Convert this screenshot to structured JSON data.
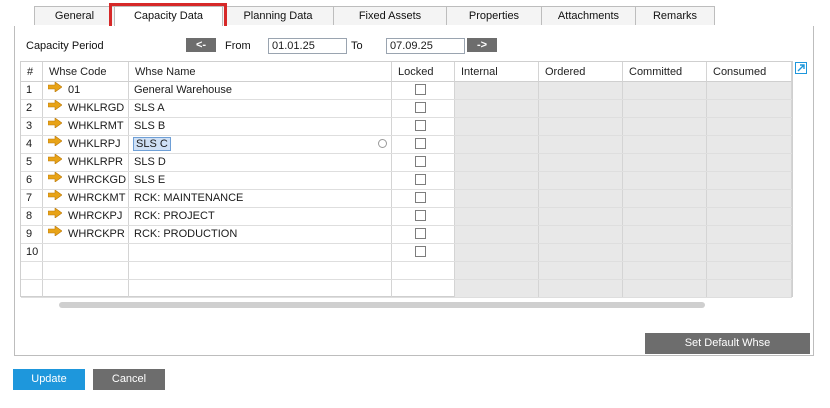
{
  "tabs": [
    {
      "label": "General"
    },
    {
      "label": "Capacity Data"
    },
    {
      "label": "Planning Data"
    },
    {
      "label": "Fixed Assets"
    },
    {
      "label": "Properties"
    },
    {
      "label": "Attachments"
    },
    {
      "label": "Remarks"
    }
  ],
  "active_tab": "Capacity Data",
  "period": {
    "label": "Capacity Period",
    "prev_label": "<-",
    "from_label": "From",
    "from_value": "01.01.25",
    "to_label": "To",
    "to_value": "07.09.25",
    "next_label": "->"
  },
  "grid": {
    "columns": [
      "#",
      "Whse Code",
      "Whse Name",
      "Locked",
      "Internal",
      "Ordered",
      "Committed",
      "Consumed"
    ],
    "rows": [
      {
        "num": "1",
        "code": "01",
        "name": "General Warehouse"
      },
      {
        "num": "2",
        "code": "WHKLRGD",
        "name": "SLS A"
      },
      {
        "num": "3",
        "code": "WHKLRMT",
        "name": "SLS B"
      },
      {
        "num": "4",
        "code": "WHKLRPJ",
        "name": "SLS C"
      },
      {
        "num": "5",
        "code": "WHKLRPR",
        "name": "SLS D"
      },
      {
        "num": "6",
        "code": "WHRCKGD",
        "name": "SLS E"
      },
      {
        "num": "7",
        "code": "WHRCKMT",
        "name": "RCK: MAINTENANCE"
      },
      {
        "num": "8",
        "code": "WHRCKPJ",
        "name": "RCK: PROJECT"
      },
      {
        "num": "9",
        "code": "WHRCKPR",
        "name": "RCK: PRODUCTION"
      },
      {
        "num": "10",
        "code": "",
        "name": ""
      }
    ],
    "selected_row": "4"
  },
  "buttons": {
    "set_default": "Set Default Whse",
    "update": "Update",
    "cancel": "Cancel"
  },
  "colors": {
    "accent_blue": "#1e97dc",
    "dark_button": "#6d6d6d",
    "arrow_orange": "#e8a317",
    "highlight_red": "#d62828"
  },
  "icons": {
    "row_link": "orange-arrow-icon",
    "expand": "expand-arrow-icon",
    "select_list": "select-list-icon"
  }
}
